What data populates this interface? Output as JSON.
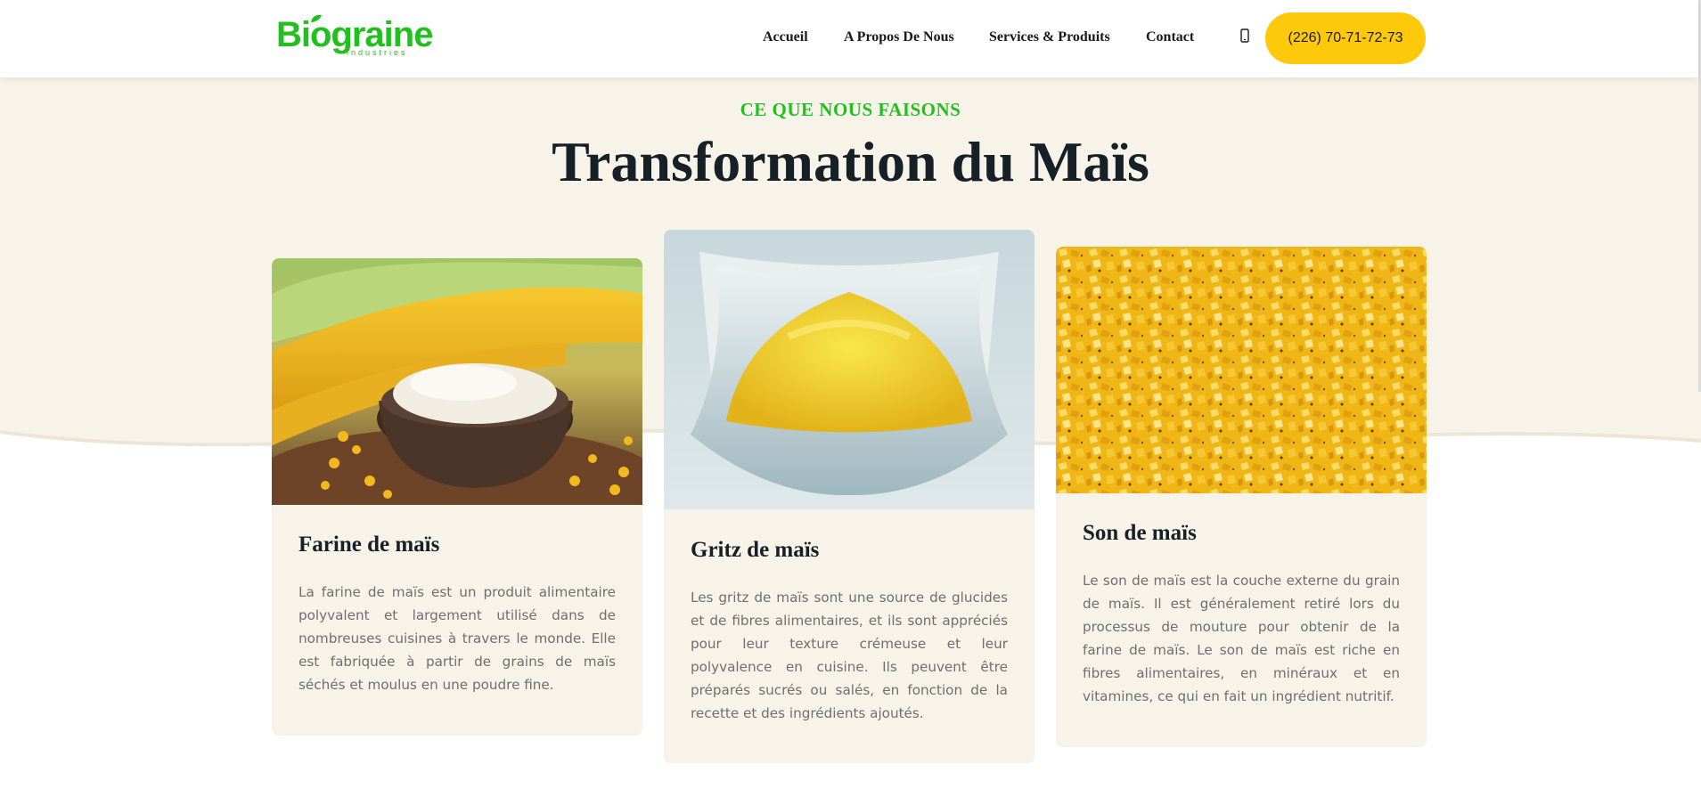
{
  "brand": {
    "logo_text": "Biograine",
    "logo_subtext": "industries",
    "color": "#22c01e"
  },
  "nav": {
    "items": [
      {
        "label": "Accueil"
      },
      {
        "label": "A Propos De Nous"
      },
      {
        "label": "Services & Produits"
      },
      {
        "label": "Contact"
      }
    ],
    "phone_icon": "mobile-phone-icon",
    "phone": "(226) 70-71-72-73",
    "phone_button_color": "#ffc90b"
  },
  "section": {
    "eyebrow": "CE QUE NOUS FAISONS",
    "title": "Transformation du Maïs"
  },
  "cards": [
    {
      "title": "Farine de maïs",
      "text": "La farine de maïs est un produit alimentaire polyvalent et largement utilisé dans de nombreuses cuisines à travers le monde. Elle est fabriquée à partir de grains de maïs séchés et moulus en une poudre fine.",
      "image": "corn-flour-bowl-photo"
    },
    {
      "title": "Gritz de maïs",
      "text": "Les gritz de maïs sont une source de glucides et de fibres alimentaires, et ils sont appréciés pour leur texture crémeuse et leur polyvalence en cuisine. Ils peuvent être préparés sucrés ou salés, en fonction de la recette et des ingrédients ajoutés.",
      "image": "corn-grits-bowl-photo"
    },
    {
      "title": "Son de maïs",
      "text": "Le son de maïs est la couche externe du grain de maïs. Il est généralement retiré lors du processus de mouture pour obtenir de la farine de maïs. Le son de maïs est riche en fibres alimentaires, en minéraux et en vitamines, ce qui en fait un ingrédient nutritif.",
      "image": "corn-bran-photo"
    }
  ]
}
